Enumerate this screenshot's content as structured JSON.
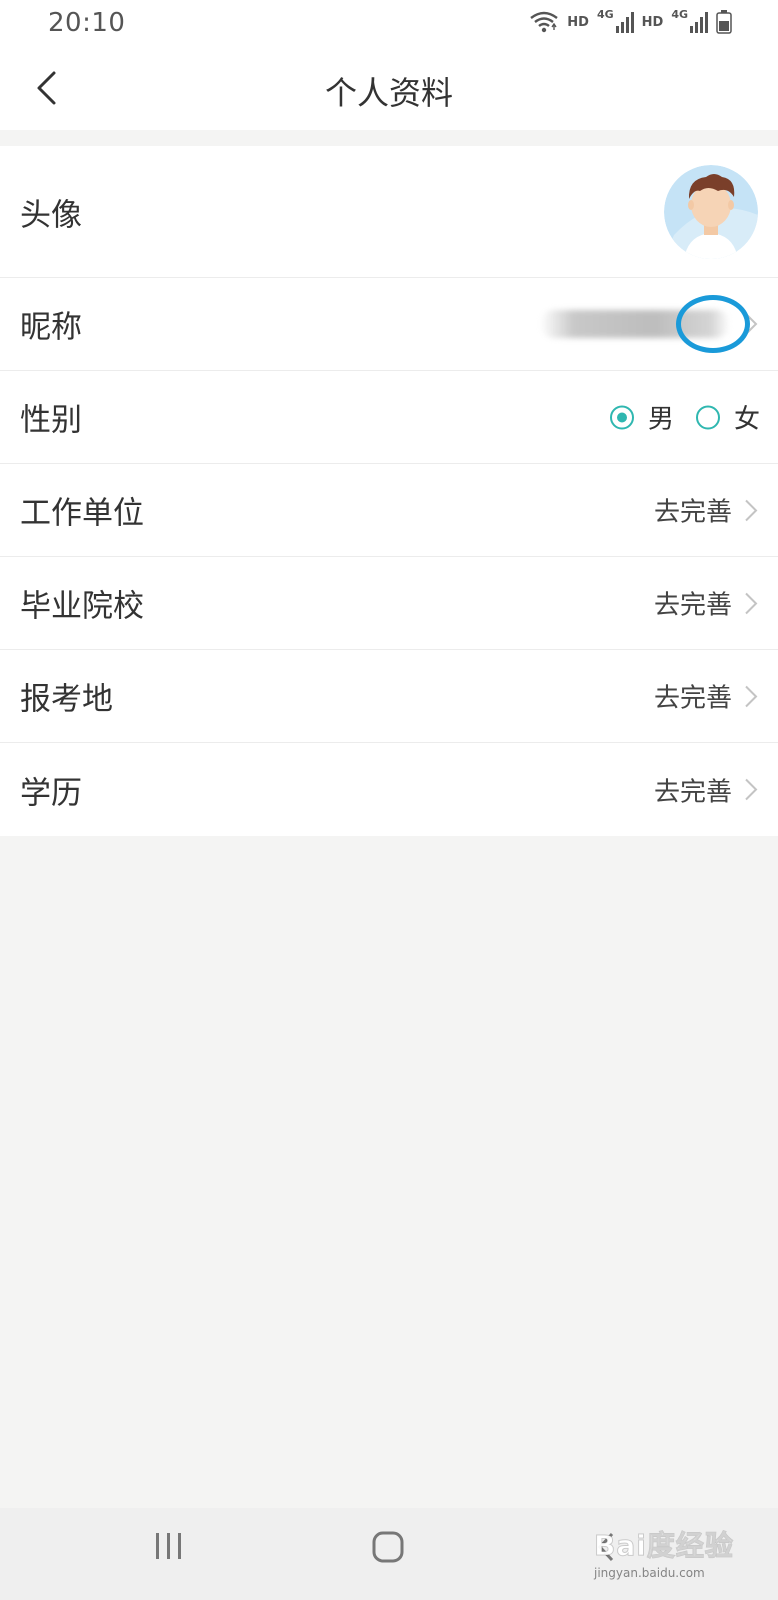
{
  "status_bar": {
    "time": "20:10",
    "hd_1": "HD",
    "net_1": "4G",
    "hd_2": "HD",
    "net_2": "4G",
    "icons": [
      "wifi-icon",
      "signal-icon",
      "signal-icon",
      "battery-icon"
    ]
  },
  "header": {
    "title": "个人资料",
    "back_icon": "chevron-left-icon"
  },
  "profile": {
    "avatar": {
      "label": "头像",
      "icon": "avatar-icon"
    },
    "nickname": {
      "label": "昵称"
    },
    "gender": {
      "label": "性别",
      "options": [
        {
          "label": "男",
          "selected": true
        },
        {
          "label": "女",
          "selected": false
        }
      ]
    },
    "work_unit": {
      "label": "工作单位",
      "value": "去完善"
    },
    "school": {
      "label": "毕业院校",
      "value": "去完善"
    },
    "exam_location": {
      "label": "报考地",
      "value": "去完善"
    },
    "education": {
      "label": "学历",
      "value": "去完善"
    }
  },
  "colors": {
    "accent": "#2fb7b0",
    "highlight": "#1a9ad9",
    "background": "#f4f4f3"
  },
  "nav_bar": {
    "icons": [
      "recent-apps-icon",
      "home-icon",
      "back-icon"
    ]
  },
  "watermark": {
    "text": "Bai度经验",
    "sub": "jingyan.baidu.com"
  }
}
